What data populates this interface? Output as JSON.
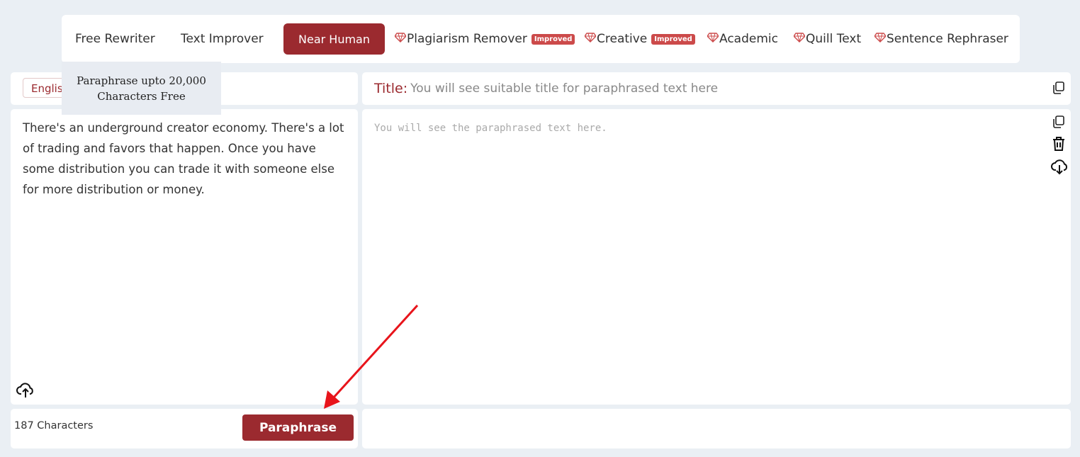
{
  "tabs": [
    {
      "label": "Free Rewriter"
    },
    {
      "label": "Text Improver"
    },
    {
      "label": "Near Human"
    },
    {
      "label": "Plagiarism Remover",
      "badge": "Improved"
    },
    {
      "label": "Creative",
      "badge": "Improved"
    },
    {
      "label": "Academic"
    },
    {
      "label": "Quill Text"
    },
    {
      "label": "Sentence Rephraser"
    }
  ],
  "gem_glyph": "💎",
  "language_select": {
    "value": "English"
  },
  "tooltip": {
    "text": "Paraphrase upto 20,000 Characters Free"
  },
  "title_bar": {
    "label": "Title:",
    "placeholder": "You will see suitable title for paraphrased text here"
  },
  "input": {
    "text": "There's an underground creator economy. There's a lot of trading and favors that happen. Once you have some distribution you can trade it with someone else for more distribution or money."
  },
  "output": {
    "placeholder": "You will see the paraphrased text here."
  },
  "footer": {
    "char_count": "187 Characters",
    "paraphrase_label": "Paraphrase"
  },
  "colors": {
    "accent": "#9b2a2f",
    "badge": "#cc4a4a",
    "background": "#eaeff4",
    "annotation_arrow": "#e8141b"
  },
  "icons": [
    "copy-icon",
    "trash-icon",
    "download-cloud-icon",
    "upload-cloud-icon",
    "gem-icon"
  ]
}
